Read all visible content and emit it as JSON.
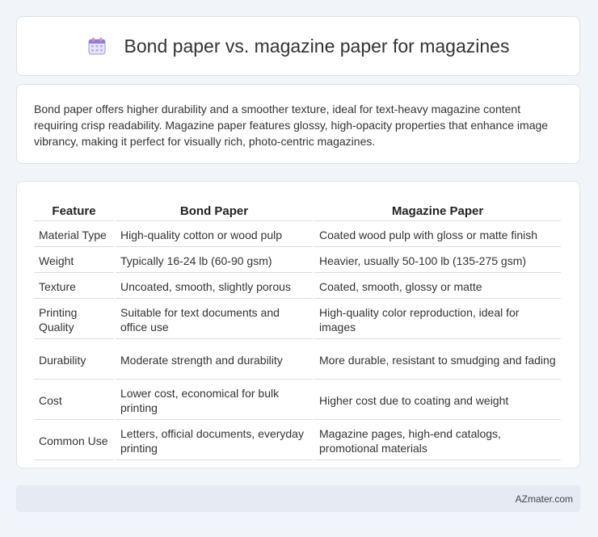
{
  "header": {
    "title": "Bond paper vs. magazine paper for magazines",
    "icon": "calendar-icon"
  },
  "description": "Bond paper offers higher durability and a smoother texture, ideal for text-heavy magazine content requiring crisp readability. Magazine paper features glossy, high-opacity properties that enhance image vibrancy, making it perfect for visually rich, photo-centric magazines.",
  "table": {
    "headers": [
      "Feature",
      "Bond Paper",
      "Magazine Paper"
    ],
    "rows": [
      [
        "Material Type",
        "High-quality cotton or wood pulp",
        "Coated wood pulp with gloss or matte finish"
      ],
      [
        "Weight",
        "Typically 16-24 lb (60-90 gsm)",
        "Heavier, usually 50-100 lb (135-275 gsm)"
      ],
      [
        "Texture",
        "Uncoated, smooth, slightly porous",
        "Coated, smooth, glossy or matte"
      ],
      [
        "Printing Quality",
        "Suitable for text documents and office use",
        "High-quality color reproduction, ideal for images"
      ],
      [
        "Durability",
        "Moderate strength and durability",
        "More durable, resistant to smudging and fading"
      ],
      [
        "Cost",
        "Lower cost, economical for bulk printing",
        "Higher cost due to coating and weight"
      ],
      [
        "Common Use",
        "Letters, official documents, everyday printing",
        "Magazine pages, high-end catalogs, promotional materials"
      ]
    ]
  },
  "footer": {
    "brand": "AZmater.com"
  },
  "colors": {
    "background": "#f1f4f9",
    "card": "#ffffff",
    "footer": "#e5eaf3",
    "icon_accent": "#7b6fd6"
  }
}
